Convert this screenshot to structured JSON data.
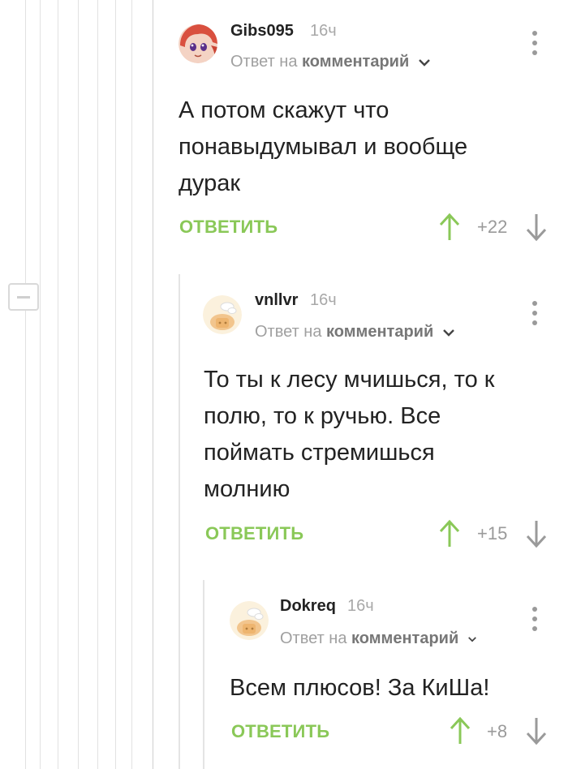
{
  "icons": {
    "collapse": "minus-icon",
    "upvote": "arrow-up-icon",
    "downvote": "arrow-down-icon",
    "menu": "kebab-icon",
    "expand": "chevron-down-icon"
  },
  "colors": {
    "accent_green": "#8ac858",
    "meta_gray": "#a0a0a0",
    "text": "#222222"
  },
  "comments": [
    {
      "username": "Gibs095",
      "time": "16ч",
      "reply_prefix": "Ответ на",
      "reply_link": "комментарий",
      "text": "А потом скажут что понавыдумывал и вообще дурак",
      "reply_label": "ОТВЕТИТЬ",
      "rating": "+22"
    },
    {
      "username": "vnllvr",
      "time": "16ч",
      "reply_prefix": "Ответ на",
      "reply_link": "комментарий",
      "text": "То ты к лесу мчишься, то к полю, то к ручью. Все поймать стремишься молнию",
      "reply_label": "ОТВЕТИТЬ",
      "rating": "+15"
    },
    {
      "username": "Dokreq",
      "time": "16ч",
      "reply_prefix": "Ответ на",
      "reply_link": "комментарий",
      "text": "Всем плюсов! За КиШа!",
      "reply_label": "ОТВЕТИТЬ",
      "rating": "+8"
    }
  ]
}
